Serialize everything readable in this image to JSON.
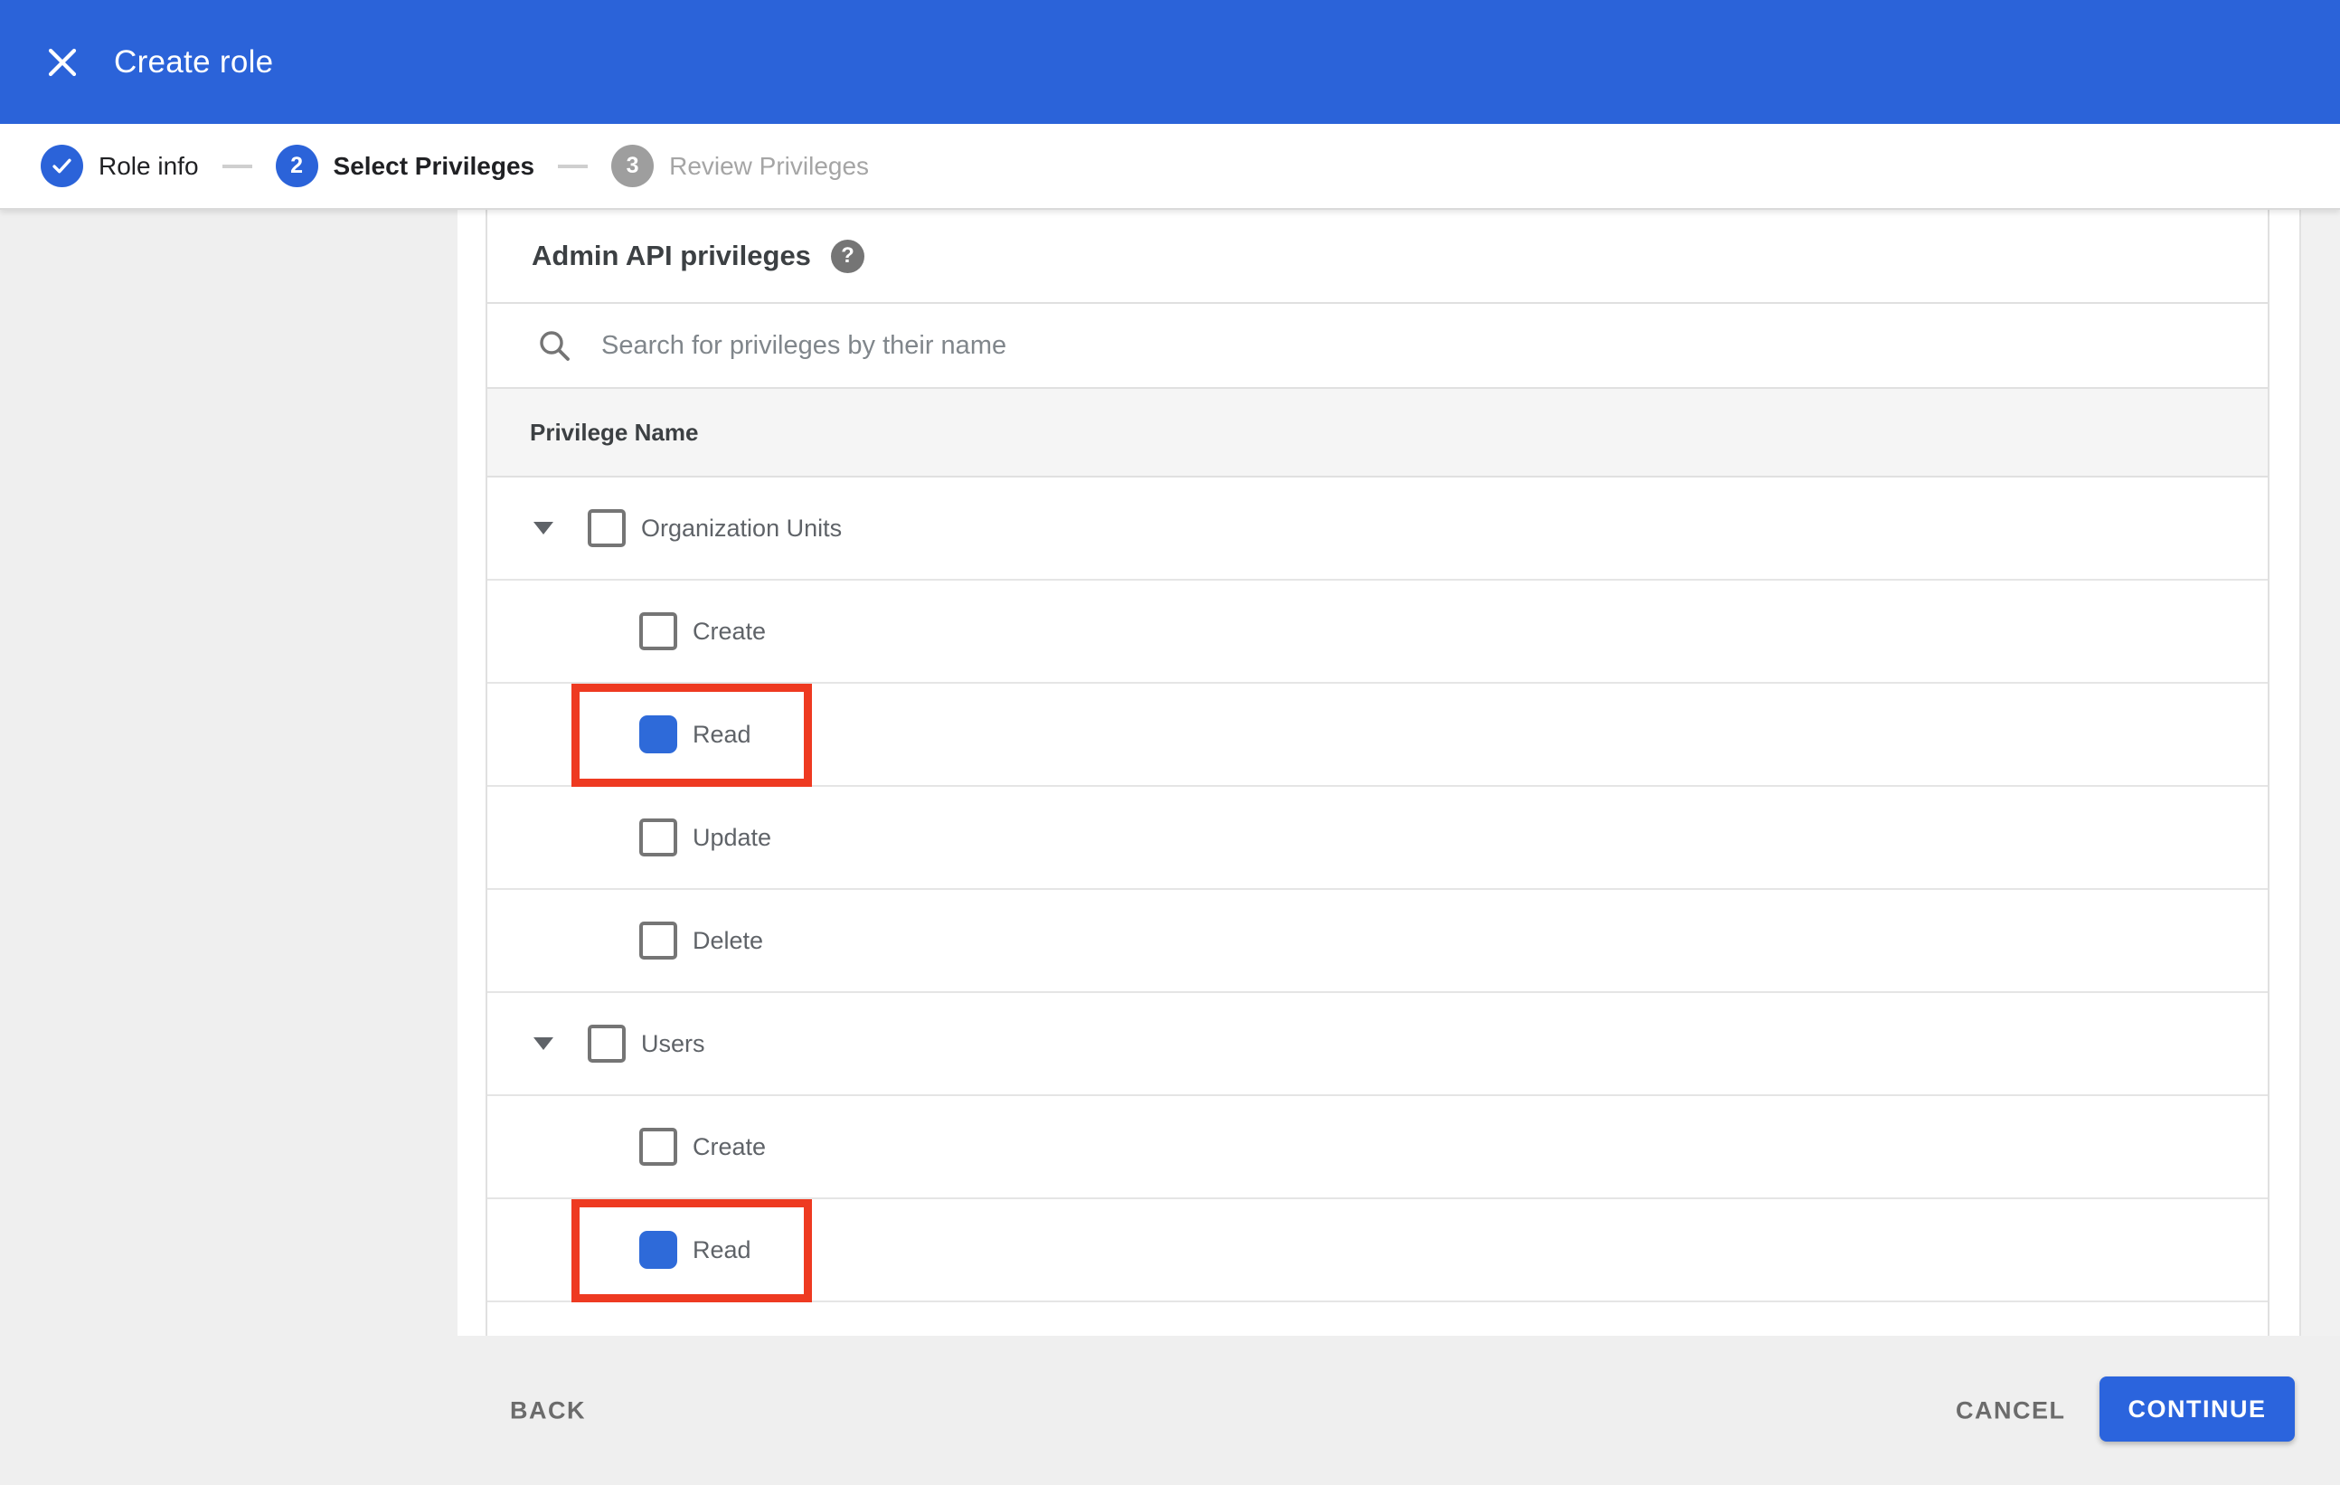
{
  "header": {
    "title": "Create role"
  },
  "stepper": {
    "steps": [
      {
        "label": "Role info",
        "status": "complete",
        "indicator": "check"
      },
      {
        "label": "Select Privileges",
        "status": "active",
        "indicator": "2"
      },
      {
        "label": "Review Privileges",
        "status": "upcoming",
        "indicator": "3"
      }
    ]
  },
  "content": {
    "section_title": "Admin API privileges",
    "help_icon": "help-icon",
    "search": {
      "placeholder": "Search for privileges by their name",
      "value": ""
    },
    "table": {
      "header": "Privilege Name",
      "rows": [
        {
          "label": "Organization Units",
          "level": 0,
          "expandable": true,
          "checked": false,
          "highlighted": false
        },
        {
          "label": "Create",
          "level": 1,
          "expandable": false,
          "checked": false,
          "highlighted": false
        },
        {
          "label": "Read",
          "level": 1,
          "expandable": false,
          "checked": true,
          "highlighted": true
        },
        {
          "label": "Update",
          "level": 1,
          "expandable": false,
          "checked": false,
          "highlighted": false
        },
        {
          "label": "Delete",
          "level": 1,
          "expandable": false,
          "checked": false,
          "highlighted": false
        },
        {
          "label": "Users",
          "level": 0,
          "expandable": true,
          "checked": false,
          "highlighted": false
        },
        {
          "label": "Create",
          "level": 1,
          "expandable": false,
          "checked": false,
          "highlighted": false
        },
        {
          "label": "Read",
          "level": 1,
          "expandable": false,
          "checked": true,
          "highlighted": true
        }
      ]
    }
  },
  "footer": {
    "back_label": "BACK",
    "cancel_label": "CANCEL",
    "continue_label": "CONTINUE"
  },
  "colors": {
    "appbar_blue": "#2b63d9",
    "checkbox_blue": "#2e6ad9",
    "continue_blue": "#2b64dd",
    "highlight_red": "#ee3a21",
    "inactive_step_gray": "#9e9e9e",
    "panel_gray": "#efefef",
    "table_header_gray": "#f5f5f5"
  }
}
